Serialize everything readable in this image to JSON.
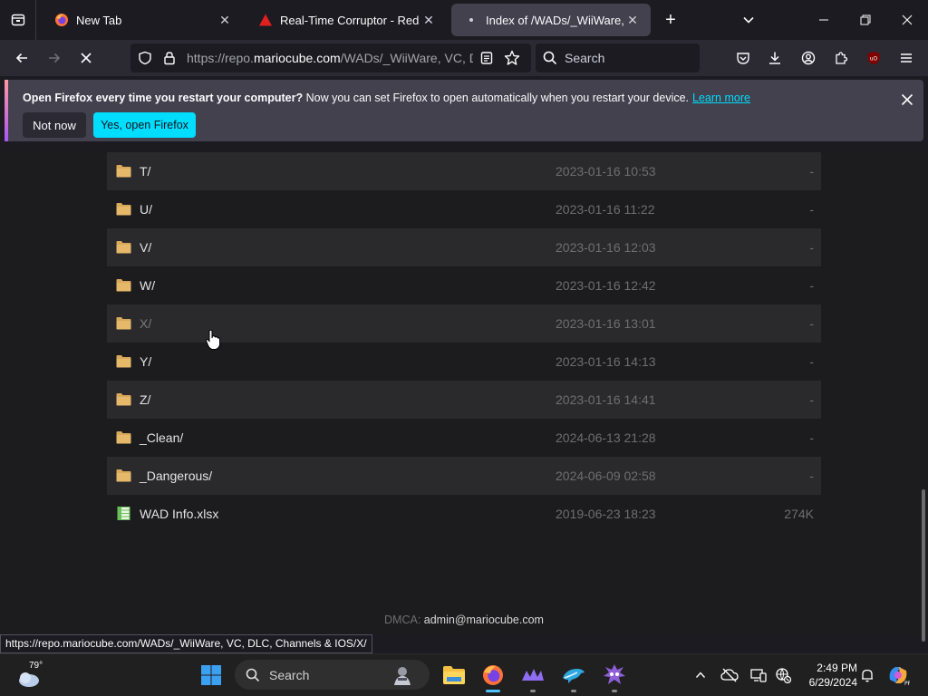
{
  "tabs": [
    {
      "title": "New Tab",
      "active": false
    },
    {
      "title": "Real-Time Corruptor - Redscien",
      "active": false
    },
    {
      "title": "Index of /WADs/_WiiWare, VC, D",
      "active": true
    }
  ],
  "navbar": {
    "url_prefix": "https://repo.",
    "url_host": "mariocube.com",
    "url_rest": "/WADs/_WiiWare, VC, D",
    "search_placeholder": "Search"
  },
  "notification": {
    "bold": "Open Firefox every time you restart your computer?",
    "text": " Now you can set Firefox to open automatically when you restart your device.",
    "link": "Learn more",
    "not_now": "Not now",
    "yes": "Yes, open Firefox"
  },
  "listing": [
    {
      "name": "T/",
      "date": "2023-01-16 10:53",
      "size": "-",
      "type": "folder"
    },
    {
      "name": "U/",
      "date": "2023-01-16 11:22",
      "size": "-",
      "type": "folder"
    },
    {
      "name": "V/",
      "date": "2023-01-16 12:03",
      "size": "-",
      "type": "folder"
    },
    {
      "name": "W/",
      "date": "2023-01-16 12:42",
      "size": "-",
      "type": "folder"
    },
    {
      "name": "X/",
      "date": "2023-01-16 13:01",
      "size": "-",
      "type": "folder"
    },
    {
      "name": "Y/",
      "date": "2023-01-16 14:13",
      "size": "-",
      "type": "folder"
    },
    {
      "name": "Z/",
      "date": "2023-01-16 14:41",
      "size": "-",
      "type": "folder"
    },
    {
      "name": "_Clean/",
      "date": "2024-06-13 21:28",
      "size": "-",
      "type": "folder"
    },
    {
      "name": "_Dangerous/",
      "date": "2024-06-09 02:58",
      "size": "-",
      "type": "folder"
    },
    {
      "name": "WAD Info.xlsx",
      "date": "2019-06-23 18:23",
      "size": "274K",
      "type": "spreadsheet"
    }
  ],
  "footer": {
    "label": "DMCA:",
    "email": "admin@mariocube.com"
  },
  "statusbar": "https://repo.mariocube.com/WADs/_WiiWare, VC, DLC, Channels & IOS/X/",
  "taskbar": {
    "weather_temp": "79°",
    "search_placeholder": "Search",
    "time": "2:49 PM",
    "date": "6/29/2024"
  },
  "colors": {
    "accent": "#00ddff",
    "folder": "#d9a95b",
    "spreadsheet": "#6abf5a"
  }
}
